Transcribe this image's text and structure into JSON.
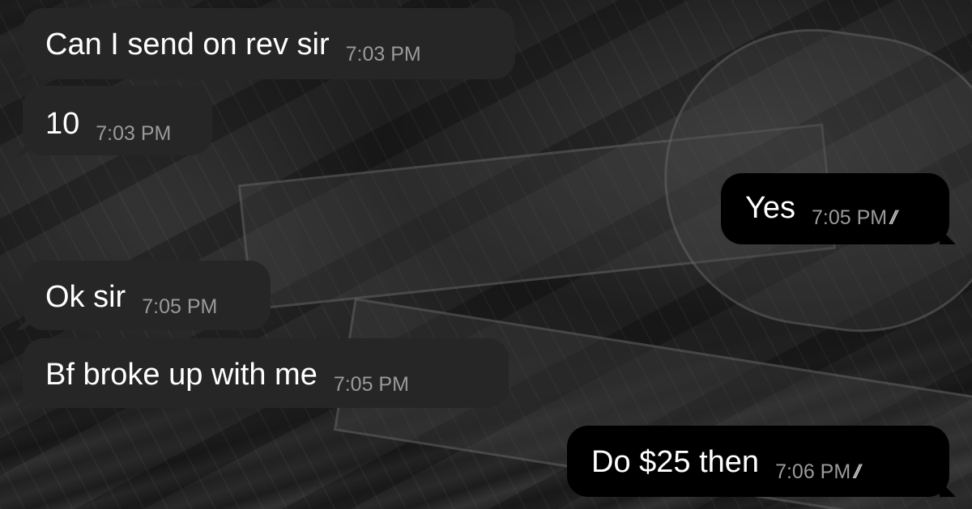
{
  "messages": [
    {
      "direction": "incoming",
      "text": "Can I send on rev sir",
      "time": "7:03 PM"
    },
    {
      "direction": "incoming",
      "text": "10",
      "time": "7:03 PM"
    },
    {
      "direction": "outgoing",
      "text": "Yes",
      "time": "7:05 PM",
      "status_icon": "double-check-icon",
      "status": "read"
    },
    {
      "direction": "incoming",
      "text": "Ok sir",
      "time": "7:05 PM"
    },
    {
      "direction": "incoming",
      "text": "Bf broke up with me",
      "time": "7:05 PM"
    },
    {
      "direction": "outgoing",
      "text": "Do $25 then",
      "time": "7:06 PM",
      "status_icon": "double-check-icon",
      "status": "read"
    }
  ],
  "colors": {
    "incoming_bubble": "#262626",
    "outgoing_bubble": "#000000",
    "timestamp": "#9a9a9a",
    "text": "#ffffff"
  }
}
